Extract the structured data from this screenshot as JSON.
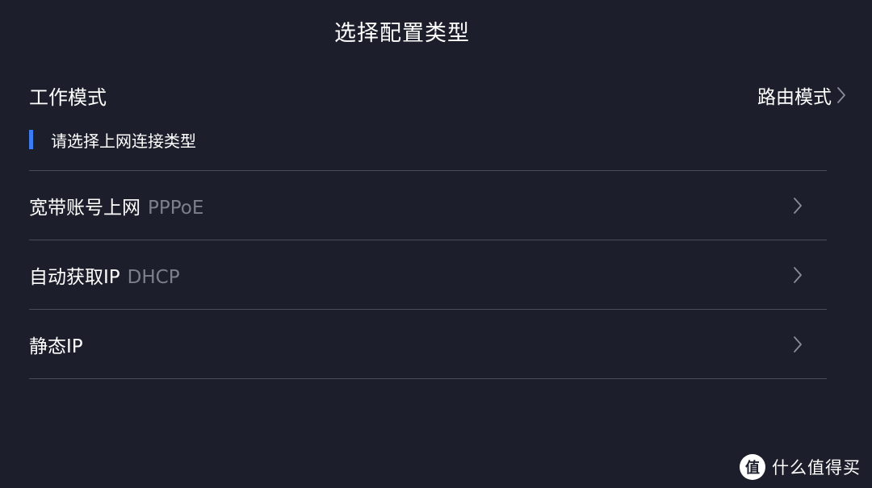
{
  "header": {
    "title": "选择配置类型"
  },
  "work_mode": {
    "label": "工作模式",
    "value": "路由模式",
    "icon": "chevron-right-icon"
  },
  "section": {
    "title": "请选择上网连接类型",
    "accent_color": "#3b7cf5"
  },
  "options": [
    {
      "label": "宽带账号上网",
      "sub": "PPPoE",
      "icon": "chevron-right-icon"
    },
    {
      "label": "自动获取IP",
      "sub": "DHCP",
      "icon": "chevron-right-icon"
    },
    {
      "label": "静态IP",
      "sub": "",
      "icon": "chevron-right-icon"
    }
  ],
  "watermark": {
    "logo": "值",
    "text": "什么值得买"
  },
  "colors": {
    "background": "#1c1e2b",
    "divider": "#4a4c58",
    "secondary_text": "#7d7f8a",
    "chevron": "#8a8c96"
  }
}
